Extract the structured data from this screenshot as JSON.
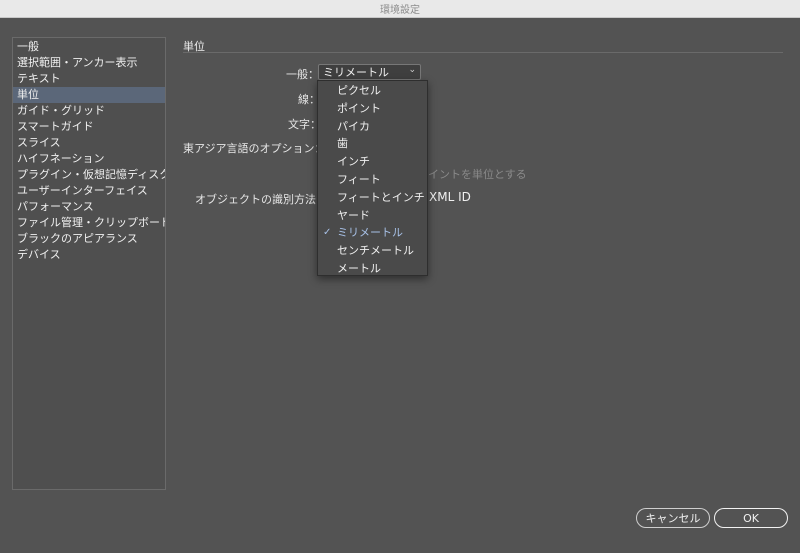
{
  "window": {
    "title": "環境設定"
  },
  "sidebar": {
    "items": [
      {
        "label": "一般"
      },
      {
        "label": "選択範囲・アンカー表示"
      },
      {
        "label": "テキスト"
      },
      {
        "label": "単位",
        "selected": true
      },
      {
        "label": "ガイド・グリッド"
      },
      {
        "label": "スマートガイド"
      },
      {
        "label": "スライス"
      },
      {
        "label": "ハイフネーション"
      },
      {
        "label": "プラグイン・仮想記憶ディスク"
      },
      {
        "label": "ユーザーインターフェイス"
      },
      {
        "label": "パフォーマンス"
      },
      {
        "label": "ファイル管理・クリップボード"
      },
      {
        "label": "ブラックのアピアランス"
      },
      {
        "label": "デバイス"
      }
    ]
  },
  "main": {
    "section_title": "単位",
    "labels": {
      "general": "一般：",
      "stroke": "線：",
      "type": "文字：",
      "east_asian": "東アジア言語のオプション：",
      "object_id": "オブジェクトの識別方法："
    },
    "general_select": {
      "value": "ミリメートル",
      "chevron_icon": "chevron-down-icon"
    },
    "partial_text_dim": "イントを単位とする",
    "partial_text_xmlid": "XML ID"
  },
  "dropdown": {
    "options": [
      {
        "label": "ピクセル"
      },
      {
        "label": "ポイント"
      },
      {
        "label": "パイカ"
      },
      {
        "label": "歯"
      },
      {
        "label": "インチ"
      },
      {
        "label": "フィート"
      },
      {
        "label": "フィートとインチ"
      },
      {
        "label": "ヤード"
      },
      {
        "label": "ミリメートル",
        "checked": true
      },
      {
        "label": "センチメートル"
      },
      {
        "label": "メートル"
      }
    ]
  },
  "buttons": {
    "cancel": "キャンセル",
    "ok": "OK"
  },
  "colors": {
    "background": "#535353",
    "selected": "#5b6779",
    "checked_text": "#a7c0e6"
  }
}
